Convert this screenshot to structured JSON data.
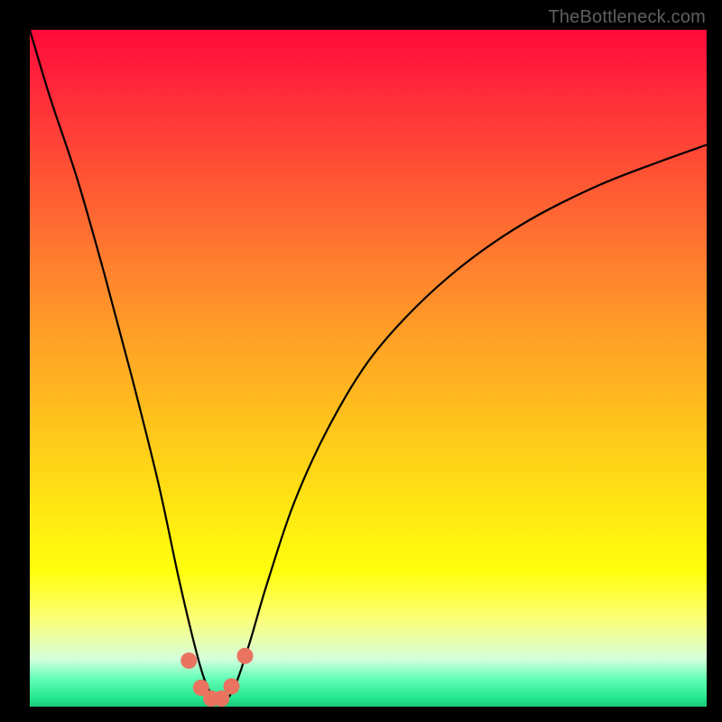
{
  "watermark": "TheBottleneck.com",
  "colors": {
    "background": "#000000",
    "gradient_top": "#ff0a3a",
    "gradient_bottom": "#1cc87c",
    "curve": "#000000",
    "marker_fill": "#e9735f",
    "marker_stroke": "#cc5a4a"
  },
  "chart_data": {
    "type": "line",
    "title": "",
    "xlabel": "",
    "ylabel": "",
    "xlim": [
      0,
      1
    ],
    "ylim": [
      0,
      1
    ],
    "notes": "Axes are unlabeled; values are normalized 0–1 estimates read from the image. y represents fractional height from bottom (0) to top (1). The curve appears to be a bottleneck/utilization curve with a sharp minimum near x≈0.28.",
    "series": [
      {
        "name": "curve",
        "x": [
          0.0,
          0.03,
          0.07,
          0.11,
          0.15,
          0.19,
          0.22,
          0.245,
          0.26,
          0.275,
          0.29,
          0.305,
          0.325,
          0.35,
          0.39,
          0.44,
          0.5,
          0.57,
          0.65,
          0.74,
          0.84,
          0.93,
          1.0
        ],
        "y": [
          1.0,
          0.9,
          0.78,
          0.64,
          0.49,
          0.33,
          0.19,
          0.085,
          0.035,
          0.01,
          0.01,
          0.035,
          0.095,
          0.18,
          0.3,
          0.41,
          0.51,
          0.59,
          0.66,
          0.72,
          0.77,
          0.805,
          0.83
        ]
      }
    ],
    "markers": {
      "name": "highlighted-points",
      "x": [
        0.235,
        0.253,
        0.268,
        0.283,
        0.298,
        0.318
      ],
      "y": [
        0.068,
        0.028,
        0.012,
        0.012,
        0.03,
        0.075
      ]
    }
  }
}
